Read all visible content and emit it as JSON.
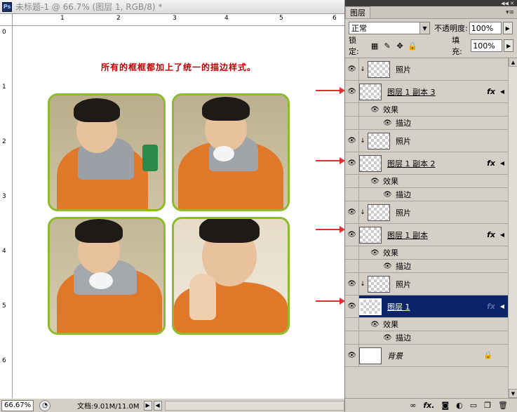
{
  "document": {
    "title": "未标题-1 @ 66.7% (图层 1, RGB/8) *",
    "app_logo": "Ps",
    "caption": "所有的框框都加上了统一的描边样式。",
    "ruler_top": [
      "1",
      "2",
      "3",
      "4",
      "5",
      "6"
    ],
    "ruler_left": [
      "0",
      "1",
      "2",
      "3",
      "4",
      "5",
      "6"
    ],
    "zoom": "66.67%",
    "doc_size": "文档:9.01M/11.0M"
  },
  "panel": {
    "tab_label": "图层",
    "blend_mode": "正常",
    "opacity_label": "不透明度:",
    "opacity_value": "100%",
    "lock_label": "锁定:",
    "fill_label": "填充:",
    "fill_value": "100%",
    "layers": [
      {
        "name": "照片",
        "clipped": true
      },
      {
        "name": "图层 1 副本 3",
        "fx": "fx",
        "effects_label": "效果",
        "stroke_label": "描边"
      },
      {
        "name": "照片",
        "clipped": true
      },
      {
        "name": "图层 1 副本 2",
        "fx": "fx",
        "effects_label": "效果",
        "stroke_label": "描边"
      },
      {
        "name": "照片",
        "clipped": true
      },
      {
        "name": "图层 1 副本",
        "fx": "fx",
        "effects_label": "效果",
        "stroke_label": "描边"
      },
      {
        "name": "照片",
        "clipped": true
      },
      {
        "name": "图层 1",
        "fx": "fx",
        "selected": true,
        "effects_label": "效果",
        "stroke_label": "描边"
      },
      {
        "name": "背景",
        "locked": true
      }
    ]
  },
  "colors": {
    "frame_stroke": "#8cbb2b",
    "caption": "#c00000",
    "selected_row": "#0a246a",
    "arrow": "#e03030"
  }
}
